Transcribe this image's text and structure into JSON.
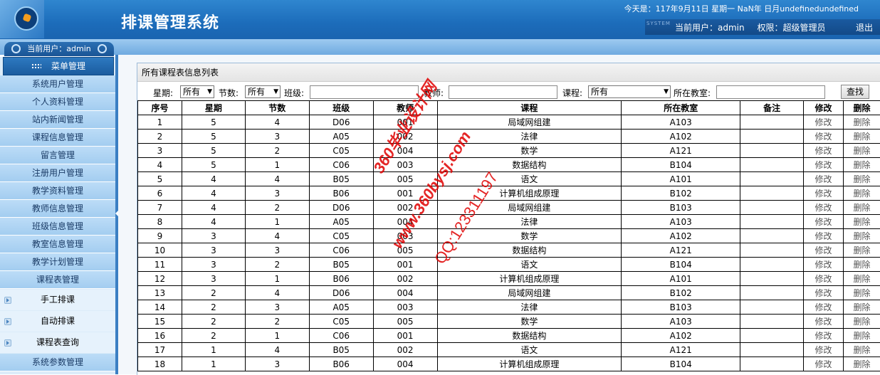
{
  "header": {
    "title": "排课管理系统",
    "date_line": "今天是：117年9月11日  星期一  NaN年 日月undefinedundefined",
    "system_mark": "SYSTEM",
    "current_user": "当前用户：admin",
    "permission": "权限：超级管理员",
    "logout": "退出"
  },
  "subbar": {
    "current_user_tab": "当前用户：admin"
  },
  "sidebar": {
    "menu_head": "菜单管理",
    "items": [
      "系统用户管理",
      "个人资料管理",
      "站内新闻管理",
      "课程信息管理",
      "留言管理",
      "注册用户管理",
      "教学资料管理",
      "教师信息管理",
      "班级信息管理",
      "教室信息管理",
      "教学计划管理",
      "课程表管理"
    ],
    "sub_items": [
      "手工排课",
      "自动排课",
      "课程表查询"
    ],
    "last_item": "系统参数管理"
  },
  "panel": {
    "title": "所有课程表信息列表",
    "filters": {
      "weekday_label": "星期:",
      "weekday_value": "所有",
      "section_label": "节数:",
      "section_value": "所有",
      "class_label": "班级:",
      "teacher_label": "教师:",
      "course_label": "课程:",
      "course_value": "所有",
      "room_label": "所在教室:",
      "search_button": "查找"
    },
    "columns": [
      "序号",
      "星期",
      "节数",
      "班级",
      "教师",
      "课程",
      "所在教室",
      "备注",
      "修改",
      "删除"
    ],
    "edit_label": "修改",
    "delete_label": "删除",
    "rows": [
      [
        "1",
        "5",
        "4",
        "D06",
        "001",
        "局域网组建",
        "A103",
        ""
      ],
      [
        "2",
        "5",
        "3",
        "A05",
        "002",
        "法律",
        "A102",
        ""
      ],
      [
        "3",
        "5",
        "2",
        "C05",
        "004",
        "数学",
        "A121",
        ""
      ],
      [
        "4",
        "5",
        "1",
        "C06",
        "003",
        "数据结构",
        "B104",
        ""
      ],
      [
        "5",
        "4",
        "4",
        "B05",
        "005",
        "语文",
        "A101",
        ""
      ],
      [
        "6",
        "4",
        "3",
        "B06",
        "001",
        "计算机组成原理",
        "B102",
        ""
      ],
      [
        "7",
        "4",
        "2",
        "D06",
        "002",
        "局域网组建",
        "B103",
        ""
      ],
      [
        "8",
        "4",
        "1",
        "A05",
        "004",
        "法律",
        "A103",
        ""
      ],
      [
        "9",
        "3",
        "4",
        "C05",
        "003",
        "数学",
        "A102",
        ""
      ],
      [
        "10",
        "3",
        "3",
        "C06",
        "005",
        "数据结构",
        "A121",
        ""
      ],
      [
        "11",
        "3",
        "2",
        "B05",
        "001",
        "语文",
        "B104",
        ""
      ],
      [
        "12",
        "3",
        "1",
        "B06",
        "002",
        "计算机组成原理",
        "A101",
        ""
      ],
      [
        "13",
        "2",
        "4",
        "D06",
        "004",
        "局域网组建",
        "B102",
        ""
      ],
      [
        "14",
        "2",
        "3",
        "A05",
        "003",
        "法律",
        "B103",
        ""
      ],
      [
        "15",
        "2",
        "2",
        "C05",
        "005",
        "数学",
        "A103",
        ""
      ],
      [
        "16",
        "2",
        "1",
        "C06",
        "001",
        "数据结构",
        "A102",
        ""
      ],
      [
        "17",
        "1",
        "4",
        "B05",
        "002",
        "语文",
        "A121",
        ""
      ],
      [
        "18",
        "1",
        "3",
        "B06",
        "004",
        "计算机组成原理",
        "B104",
        ""
      ]
    ]
  },
  "watermark": {
    "line1": "360毕业设计网",
    "line2": "www.360bysj.com",
    "line3": "QQ:123311197"
  },
  "colors": {
    "header_blue": "#1c6cba",
    "sidebar_item": "#a3cdf0",
    "watermark_red": "#e00000"
  }
}
